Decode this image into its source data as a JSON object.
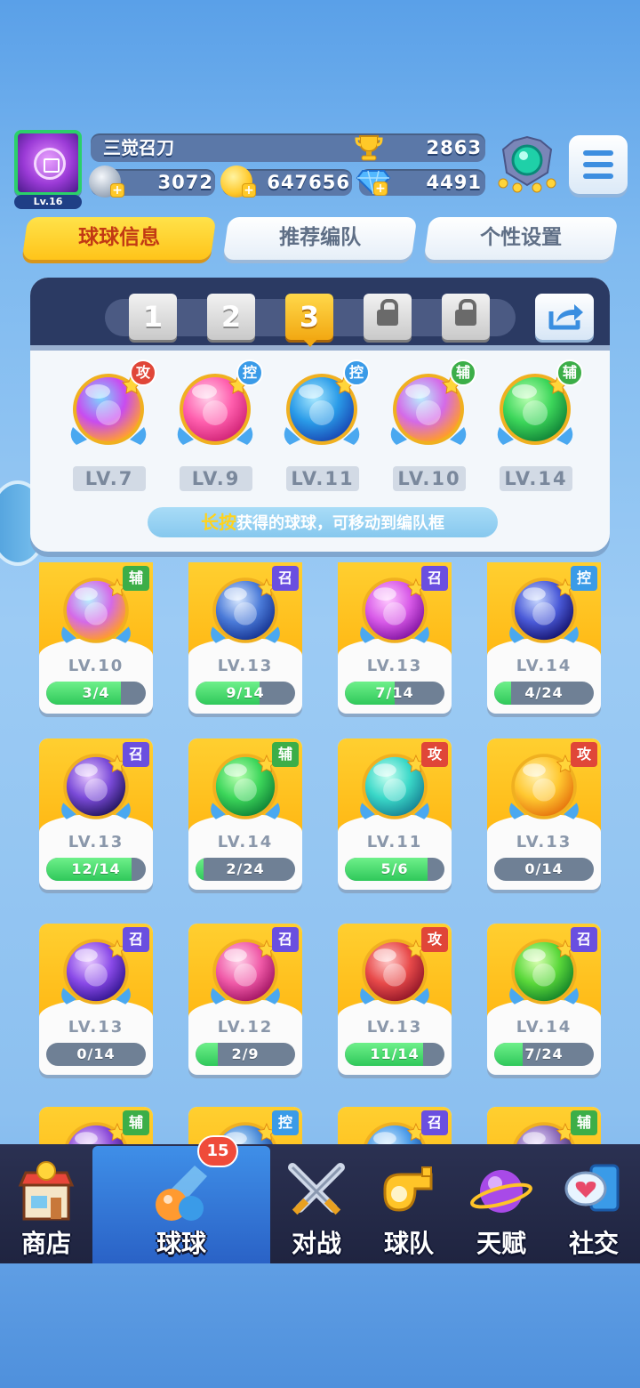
{
  "player": {
    "name": "三觉召刀",
    "level": "Lv.16",
    "trophies": "2863",
    "silver": "3072",
    "gold": "647656",
    "diamonds": "4491"
  },
  "tabs": [
    {
      "label": "球球信息",
      "active": true
    },
    {
      "label": "推荐编队",
      "active": false
    },
    {
      "label": "个性设置",
      "active": false
    }
  ],
  "team_slots": [
    {
      "label": "1",
      "state": "normal"
    },
    {
      "label": "2",
      "state": "normal"
    },
    {
      "label": "3",
      "state": "active"
    },
    {
      "label": "",
      "state": "locked"
    },
    {
      "label": "",
      "state": "locked"
    }
  ],
  "team": [
    {
      "level": "LV.7",
      "tag": "攻",
      "tag_color": "#e04638",
      "colors": [
        "#7ad8ff",
        "#c84cf0",
        "#ff9a3a"
      ],
      "icon": "triangle-prism-icon"
    },
    {
      "level": "LV.9",
      "tag": "控",
      "tag_color": "#3a9be8",
      "colors": [
        "#ffd0ea",
        "#ff5fae",
        "#d4287a"
      ],
      "icon": "heart-icon"
    },
    {
      "level": "LV.11",
      "tag": "控",
      "tag_color": "#3a9be8",
      "colors": [
        "#a8e8ff",
        "#2a9be8",
        "#1a4fb8"
      ],
      "icon": "cloud-wave-icon"
    },
    {
      "level": "LV.10",
      "tag": "辅",
      "tag_color": "#3cae48",
      "colors": [
        "#b8f0ff",
        "#d46ae8",
        "#ff9a30"
      ],
      "icon": "figures-icon"
    },
    {
      "level": "LV.14",
      "tag": "辅",
      "tag_color": "#3cae48",
      "colors": [
        "#b8ffb0",
        "#3cd65a",
        "#148a3a"
      ],
      "icon": "star-arrow-icon"
    }
  ],
  "hint": {
    "highlight": "长按",
    "text": "获得的球球，可移动到编队框"
  },
  "balls": [
    {
      "level": "LV.10",
      "progress": "3/4",
      "fill": 0.75,
      "tag": "辅",
      "tag_color": "#3cae48",
      "colors": [
        "#b8f0ff",
        "#d46ae8",
        "#ff9a30"
      ],
      "icon": "figures-icon"
    },
    {
      "level": "LV.13",
      "progress": "9/14",
      "fill": 0.64,
      "tag": "召",
      "tag_color": "#6a4fe0",
      "colors": [
        "#d8e8ff",
        "#4a7ad8",
        "#1a3a98"
      ],
      "icon": "vortex-icon"
    },
    {
      "level": "LV.13",
      "progress": "7/14",
      "fill": 0.5,
      "tag": "召",
      "tag_color": "#6a4fe0",
      "colors": [
        "#ffc8ff",
        "#d85ae8",
        "#8a1aa8"
      ],
      "icon": "mushroom-icon"
    },
    {
      "level": "LV.14",
      "progress": "4/24",
      "fill": 0.17,
      "tag": "控",
      "tag_color": "#3a9be8",
      "colors": [
        "#c8d8ff",
        "#4a5ad8",
        "#1a1a78"
      ],
      "icon": "clock-icon"
    },
    {
      "level": "LV.13",
      "progress": "12/14",
      "fill": 0.86,
      "tag": "召",
      "tag_color": "#6a4fe0",
      "colors": [
        "#e8c8ff",
        "#7a4ad8",
        "#2a1a68"
      ],
      "icon": "ghost-icon"
    },
    {
      "level": "LV.14",
      "progress": "2/24",
      "fill": 0.08,
      "tag": "辅",
      "tag_color": "#3cae48",
      "colors": [
        "#b8ffb0",
        "#3cd65a",
        "#148a3a"
      ],
      "icon": "star-arrow-icon"
    },
    {
      "level": "LV.11",
      "progress": "5/6",
      "fill": 0.83,
      "tag": "攻",
      "tag_color": "#e04638",
      "colors": [
        "#c8fff0",
        "#3ad8c8",
        "#1a8a98"
      ],
      "icon": "tornado-icon"
    },
    {
      "level": "LV.13",
      "progress": "0/14",
      "fill": 0,
      "tag": "攻",
      "tag_color": "#e04638",
      "colors": [
        "#fff0b0",
        "#ffc830",
        "#e87a10"
      ],
      "icon": "shuriken-icon"
    },
    {
      "level": "LV.13",
      "progress": "0/14",
      "fill": 0,
      "tag": "召",
      "tag_color": "#6a4fe0",
      "colors": [
        "#e8c8ff",
        "#8a4ae8",
        "#3a1a98"
      ],
      "icon": "planet-icon"
    },
    {
      "level": "LV.12",
      "progress": "2/9",
      "fill": 0.22,
      "tag": "召",
      "tag_color": "#6a4fe0",
      "colors": [
        "#ffd0e8",
        "#f05aa8",
        "#a81a68"
      ],
      "icon": "blade-icon"
    },
    {
      "level": "LV.13",
      "progress": "11/14",
      "fill": 0.79,
      "tag": "攻",
      "tag_color": "#e04638",
      "colors": [
        "#ffc8c8",
        "#e84a4a",
        "#981a2a"
      ],
      "icon": "fist-icon"
    },
    {
      "level": "LV.14",
      "progress": "7/24",
      "fill": 0.29,
      "tag": "召",
      "tag_color": "#6a4fe0",
      "colors": [
        "#d8ffb0",
        "#5ad83a",
        "#1a8a2a"
      ],
      "icon": "hexagram-icon"
    },
    {
      "level": "",
      "progress": "",
      "fill": 0,
      "tag": "辅",
      "tag_color": "#3cae48",
      "colors": [
        "#e8c8ff",
        "#8a4ad8",
        "#3a1a78"
      ],
      "icon": "ball-icon"
    },
    {
      "level": "",
      "progress": "",
      "fill": 0,
      "tag": "控",
      "tag_color": "#3a9be8",
      "colors": [
        "#c8e8ff",
        "#4a8ad8",
        "#1a3a88"
      ],
      "icon": "ball-icon"
    },
    {
      "level": "",
      "progress": "",
      "fill": 0,
      "tag": "召",
      "tag_color": "#6a4fe0",
      "colors": [
        "#c8e8ff",
        "#4a9ae8",
        "#1a4a98"
      ],
      "icon": "ball-icon"
    },
    {
      "level": "",
      "progress": "",
      "fill": 0,
      "tag": "辅",
      "tag_color": "#3cae48",
      "colors": [
        "#e8d8ff",
        "#8a6ab8",
        "#3a2a58"
      ],
      "icon": "ball-icon"
    }
  ],
  "nav": [
    {
      "label": "商店",
      "icon": "shop-icon",
      "active": false
    },
    {
      "label": "球球",
      "icon": "balls-icon",
      "active": true,
      "badge": "15"
    },
    {
      "label": "对战",
      "icon": "crossed-swords-icon",
      "active": false
    },
    {
      "label": "球队",
      "icon": "whistle-icon",
      "active": false
    },
    {
      "label": "天赋",
      "icon": "planet-talent-icon",
      "active": false
    },
    {
      "label": "社交",
      "icon": "chat-phone-icon",
      "active": false
    }
  ]
}
